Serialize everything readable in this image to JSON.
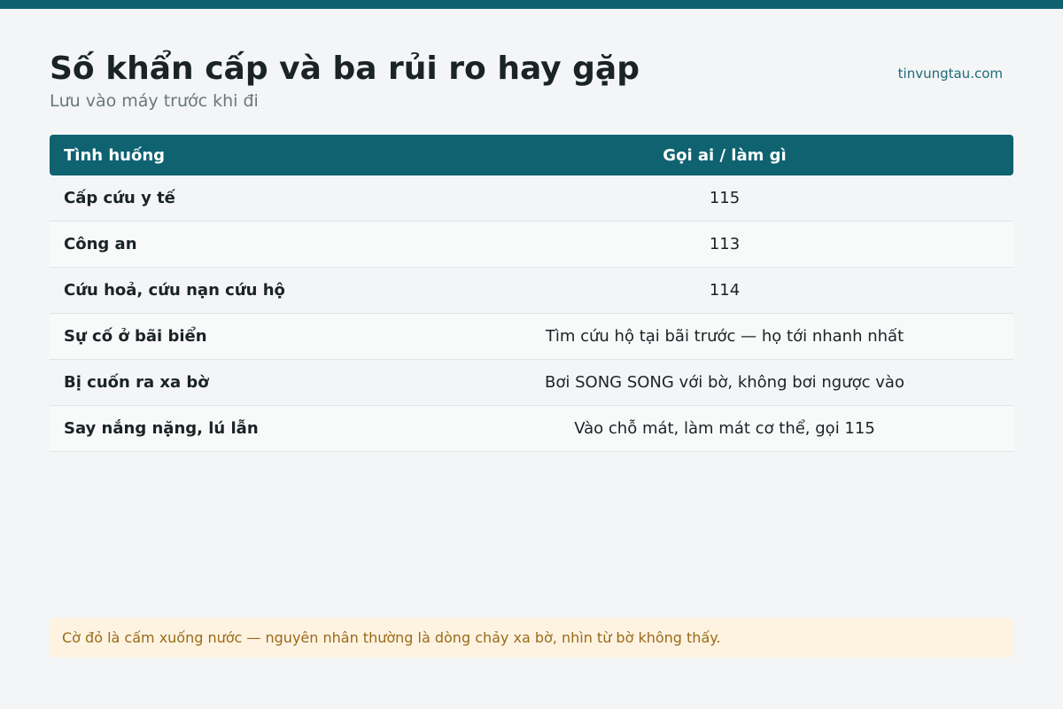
{
  "header": {
    "title": "Số khẩn cấp và ba rủi ro hay gặp",
    "subtitle": "Lưu vào máy trước khi đi",
    "site": "tinvungtau.com"
  },
  "table": {
    "columns": [
      "Tình huống",
      "Gọi ai / làm gì"
    ],
    "rows": [
      {
        "situation": "Cấp cứu y tế",
        "action": "115"
      },
      {
        "situation": "Công an",
        "action": "113"
      },
      {
        "situation": "Cứu hoả, cứu nạn cứu hộ",
        "action": "114"
      },
      {
        "situation": "Sự cố ở bãi biển",
        "action": "Tìm cứu hộ tại bãi trước — họ tới nhanh nhất"
      },
      {
        "situation": "Bị cuốn ra xa bờ",
        "action": "Bơi SONG SONG với bờ, không bơi ngược vào"
      },
      {
        "situation": "Say nắng nặng, lú lẫn",
        "action": "Vào chỗ mát, làm mát cơ thể, gọi 115"
      }
    ]
  },
  "note": {
    "text": "Cờ đỏ là cấm xuống nước — nguyên nhân thường là dòng chảy xa bờ, nhìn từ bờ không thấy."
  },
  "colors": {
    "accent": "#0f6270",
    "background": "#f3f5f7",
    "note_bg": "#fdf3e0",
    "note_text": "#9a6a1a"
  }
}
